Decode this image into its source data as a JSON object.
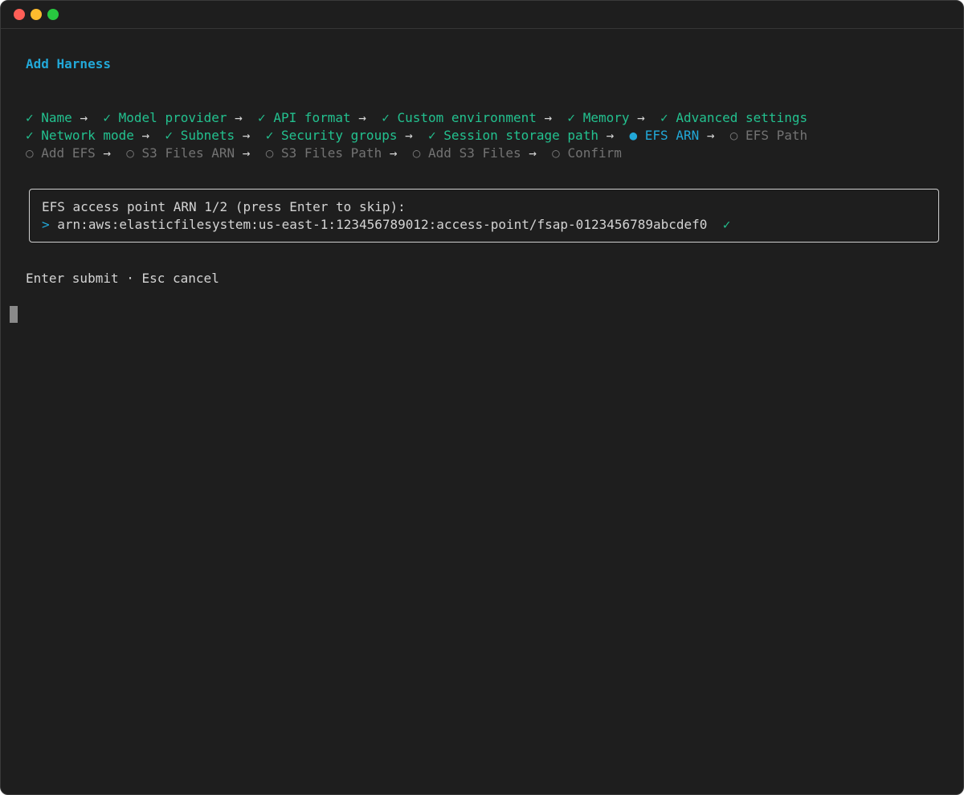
{
  "window": {
    "title": "Add Harness"
  },
  "steps": {
    "row1": [
      {
        "status_icon": "✓",
        "label": "Name"
      },
      {
        "status_icon": "✓",
        "label": "Model provider"
      },
      {
        "status_icon": "✓",
        "label": "API format"
      },
      {
        "status_icon": "✓",
        "label": "Custom environment"
      },
      {
        "status_icon": "✓",
        "label": "Memory"
      },
      {
        "status_icon": "✓",
        "label": "Advanced settings"
      }
    ],
    "row2": [
      {
        "status_icon": "✓",
        "label": "Network mode"
      },
      {
        "status_icon": "✓",
        "label": "Subnets"
      },
      {
        "status_icon": "✓",
        "label": "Security groups"
      },
      {
        "status_icon": "✓",
        "label": "Session storage path"
      },
      {
        "status_icon": "●",
        "label": "EFS ARN"
      },
      {
        "status_icon": "○",
        "label": "EFS Path"
      }
    ],
    "row3": [
      {
        "status_icon": "○",
        "label": "Add EFS"
      },
      {
        "status_icon": "○",
        "label": "S3 Files ARN"
      },
      {
        "status_icon": "○",
        "label": "S3 Files Path"
      },
      {
        "status_icon": "○",
        "label": "Add S3 Files"
      },
      {
        "status_icon": "○",
        "label": "Confirm"
      }
    ],
    "arrow": "→"
  },
  "prompt": {
    "label": "EFS access point ARN 1/2 (press Enter to skip):",
    "caret": ">",
    "value": "arn:aws:elasticfilesystem:us-east-1:123456789012:access-point/fsap-0123456789abcdef0",
    "valid_mark": "✓"
  },
  "hint": "Enter submit · Esc cancel",
  "colors": {
    "background": "#1e1e1e",
    "accent": "#22a8d8",
    "done": "#23c18f",
    "pending": "#737373"
  }
}
